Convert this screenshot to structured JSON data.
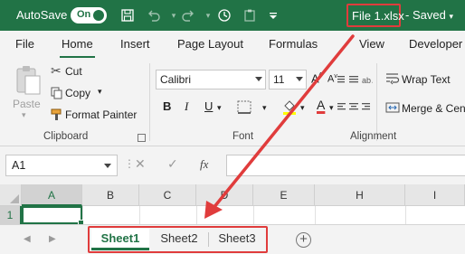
{
  "titlebar": {
    "autosave_label": "AutoSave",
    "autosave_state": "On",
    "filename": "File 1.xlsx",
    "saved_status": "- Saved",
    "saved_dropdown_icon": "chevron-down-icon",
    "icons": [
      "save-icon",
      "undo-icon",
      "redo-icon",
      "autosave-clock-icon",
      "paste-clipboard-icon",
      "customize-toolbar-icon"
    ]
  },
  "tabs": [
    {
      "label": "File"
    },
    {
      "label": "Home"
    },
    {
      "label": "Insert"
    },
    {
      "label": "Page Layout"
    },
    {
      "label": "Formulas"
    },
    {
      "label": "View"
    },
    {
      "label": "Developer"
    }
  ],
  "ribbon": {
    "clipboard": {
      "paste": "Paste",
      "cut": "Cut",
      "copy": "Copy",
      "format_painter": "Format Painter",
      "group_label": "Clipboard"
    },
    "font": {
      "font_name": "Calibri",
      "font_size": "11",
      "bold": "B",
      "italic": "I",
      "underline": "U",
      "font_color_glyph": "A",
      "group_label": "Font"
    },
    "alignment": {
      "wrap_text": "Wrap Text",
      "merge": "Merge & Cen",
      "group_label": "Alignment"
    }
  },
  "formula_bar": {
    "name_box": "A1",
    "fx": "fx",
    "formula": ""
  },
  "grid": {
    "columns": [
      "A",
      "B",
      "C",
      "D",
      "E",
      "H",
      "I"
    ],
    "rows": [
      "1"
    ],
    "active_cell": "A1"
  },
  "sheets": [
    {
      "label": "Sheet1",
      "active": true
    },
    {
      "label": "Sheet2",
      "active": false
    },
    {
      "label": "Sheet3",
      "active": false
    }
  ],
  "add_sheet": "+",
  "colors": {
    "brand": "#217346",
    "highlight": "#e03c3c"
  }
}
